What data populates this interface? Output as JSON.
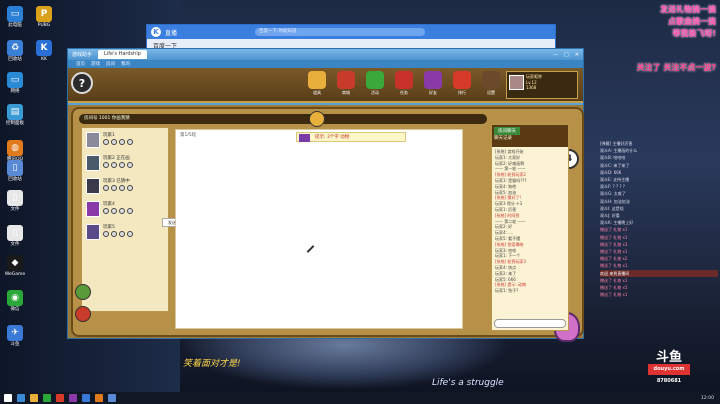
{
  "desktop_icons": [
    {
      "label": "此电脑",
      "color": "#2a7fd6",
      "glyph": "▭"
    },
    {
      "label": "PUBG",
      "color": "#d9a21a",
      "glyph": "P"
    },
    {
      "label": "回收站",
      "color": "#3a7fd6",
      "glyph": "♻"
    },
    {
      "label": "KK",
      "color": "#2a6fd6",
      "glyph": "K"
    },
    {
      "label": "网络",
      "color": "#2a8ad6",
      "glyph": "▭"
    },
    {
      "label": "控制面板",
      "color": "#3a9ad6",
      "glyph": "▤"
    },
    {
      "label": "腾讯QQ",
      "color": "#e07a1a",
      "glyph": "◍"
    },
    {
      "label": "回收站",
      "color": "#5a8ad6",
      "glyph": "▯"
    },
    {
      "label": "文件",
      "color": "#e8e8e8",
      "glyph": "▯"
    },
    {
      "label": "文件",
      "color": "#e8e8e8",
      "glyph": "▯"
    },
    {
      "label": "WeGame",
      "color": "#1a1a1a",
      "glyph": "◆"
    },
    {
      "label": "微信",
      "color": "#2aa83a",
      "glyph": "◉"
    },
    {
      "label": "斗鱼",
      "color": "#3a7ad6",
      "glyph": "✈"
    }
  ],
  "browser_window": {
    "title": "直播",
    "tab_label": "百度一下",
    "url_placeholder": "百度一下,你就知道"
  },
  "main_window": {
    "title": "游戏助手",
    "tab_label": "Life's Hardship",
    "nav_items": [
      "首页",
      "游戏",
      "房间",
      "我的"
    ],
    "window_controls": [
      "—",
      "□",
      "✕"
    ]
  },
  "game": {
    "logo_glyph": "?",
    "top_buttons": [
      {
        "label": "道具",
        "color": "#e8b03a"
      },
      {
        "label": "商城",
        "color": "#c83a2a"
      },
      {
        "label": "活动",
        "color": "#3aa83a"
      },
      {
        "label": "任务",
        "color": "#c8322a"
      },
      {
        "label": "好友",
        "color": "#8a3aa8"
      },
      {
        "label": "排行",
        "color": "#d83a2a"
      },
      {
        "label": "设置",
        "color": "#6a4a2a"
      },
      {
        "label": "帮助",
        "color": "#d87a2a"
      }
    ],
    "user": {
      "name": "玩家昵称",
      "level": "Lv.12",
      "coins": "1368"
    },
    "room_bar": "房间号 1001  你画我猜",
    "timer": "4",
    "canvas_label": "第1/5轮",
    "hint_text": "提示: 3个字 动物",
    "chat_small": "发送",
    "players": [
      {
        "name": "玩家1",
        "avatar_color": "#8a8a9a"
      },
      {
        "name": "玩家2 正在画",
        "avatar_color": "#4a5a6a"
      },
      {
        "name": "玩家3 已猜中",
        "avatar_color": "#3a3a4a"
      },
      {
        "name": "玩家4",
        "avatar_color": "#8a3aa8"
      },
      {
        "name": "玩家5",
        "avatar_color": "#5a4a8a"
      }
    ],
    "right_panel_tag": "房间聊天",
    "right_panel_title": "聊天记录",
    "messages": [
      {
        "text": "[系统] 游戏开始",
        "me": false
      },
      {
        "text": "玩家1: 大家好",
        "me": false
      },
      {
        "text": "玩家2: 好难画啊",
        "me": false
      },
      {
        "text": "—— 第一轮 ——",
        "me": false
      },
      {
        "text": "[系统] 轮到玩家2",
        "me": true
      },
      {
        "text": "玩家3: 是猫吗???",
        "me": false
      },
      {
        "text": "玩家4: 狗吧",
        "me": false
      },
      {
        "text": "玩家5: 加油",
        "me": false
      },
      {
        "text": "[系统] 猜对了!",
        "me": true
      },
      {
        "text": "玩家3 得分 +3",
        "me": false
      },
      {
        "text": "玩家1: 厉害",
        "me": false
      },
      {
        "text": "[系统] 时间到",
        "me": true
      },
      {
        "text": "—— 第二轮 ——",
        "me": false
      },
      {
        "text": "玩家2: 好",
        "me": false
      },
      {
        "text": "玩家4: ....",
        "me": false
      },
      {
        "text": "玩家5: 看不懂",
        "me": false
      },
      {
        "text": "[系统] 答案揭晓",
        "me": true
      },
      {
        "text": "玩家3: 哈哈",
        "me": false
      },
      {
        "text": "玩家1: 下一个",
        "me": false
      },
      {
        "text": "[系统] 轮到玩家3",
        "me": true
      },
      {
        "text": "玩家4: 快点",
        "me": false
      },
      {
        "text": "玩家2: 来了",
        "me": false
      },
      {
        "text": "玩家5: 666",
        "me": false
      },
      {
        "text": "[系统] 提示: 动物",
        "me": true
      },
      {
        "text": "玩家1: 兔子?",
        "me": false
      }
    ]
  },
  "overlay": {
    "line1": "发送礼物搞一搞",
    "line2": "点歌曲搞一搞",
    "line3": "带我装飞呀!",
    "line4": "关注了 关注不点一波?",
    "subtitle": "笑着面对才是!",
    "lifes": "Life's a struggle",
    "brand": "斗鱼",
    "brand_sub": "douyu.com",
    "room_no": "8780681"
  },
  "chat_lines": [
    {
      "text": "[弹幕] 主播好厉害",
      "type": "n"
    },
    {
      "text": "观众A: 主播画的什么",
      "type": "n"
    },
    {
      "text": "观众B: 哈哈哈",
      "type": "n"
    },
    {
      "text": "观众C: 来了来了",
      "type": "n"
    },
    {
      "text": "观众D: 666",
      "type": "n"
    },
    {
      "text": "观众E: 支持主播",
      "type": "n"
    },
    {
      "text": "观众F: ? ? ? ?",
      "type": "n"
    },
    {
      "text": "观众G: 太难了",
      "type": "n"
    },
    {
      "text": "观众H: 加油加油",
      "type": "n"
    },
    {
      "text": "观众I: 这是啥",
      "type": "n"
    },
    {
      "text": "观众J: 好看",
      "type": "n"
    },
    {
      "text": "观众K: 主播晚上好",
      "type": "n"
    },
    {
      "text": "赠送了 礼物 x1",
      "type": "p"
    },
    {
      "text": "赠送了 礼物 x1",
      "type": "p"
    },
    {
      "text": "赠送了 礼物 x3",
      "type": "p"
    },
    {
      "text": "赠送了 礼物 x1",
      "type": "p"
    },
    {
      "text": "赠送了 礼物 x2",
      "type": "p"
    },
    {
      "text": "赠送了 礼物 x1",
      "type": "p"
    },
    {
      "text": "欢迎 来到直播间",
      "type": "hl"
    },
    {
      "text": "赠送了 礼物 x1",
      "type": "p"
    },
    {
      "text": "赠送了 礼物 x5",
      "type": "p"
    },
    {
      "text": "赠送了 礼物 x1",
      "type": "p"
    }
  ],
  "taskbar": {
    "clock": "12:00",
    "apps": [
      "#3a8ad6",
      "#e8b03a",
      "#2aa83a",
      "#d83a2a",
      "#8a3aa8",
      "#3a7ad6",
      "#e07a1a",
      "#5a8ad6"
    ]
  }
}
